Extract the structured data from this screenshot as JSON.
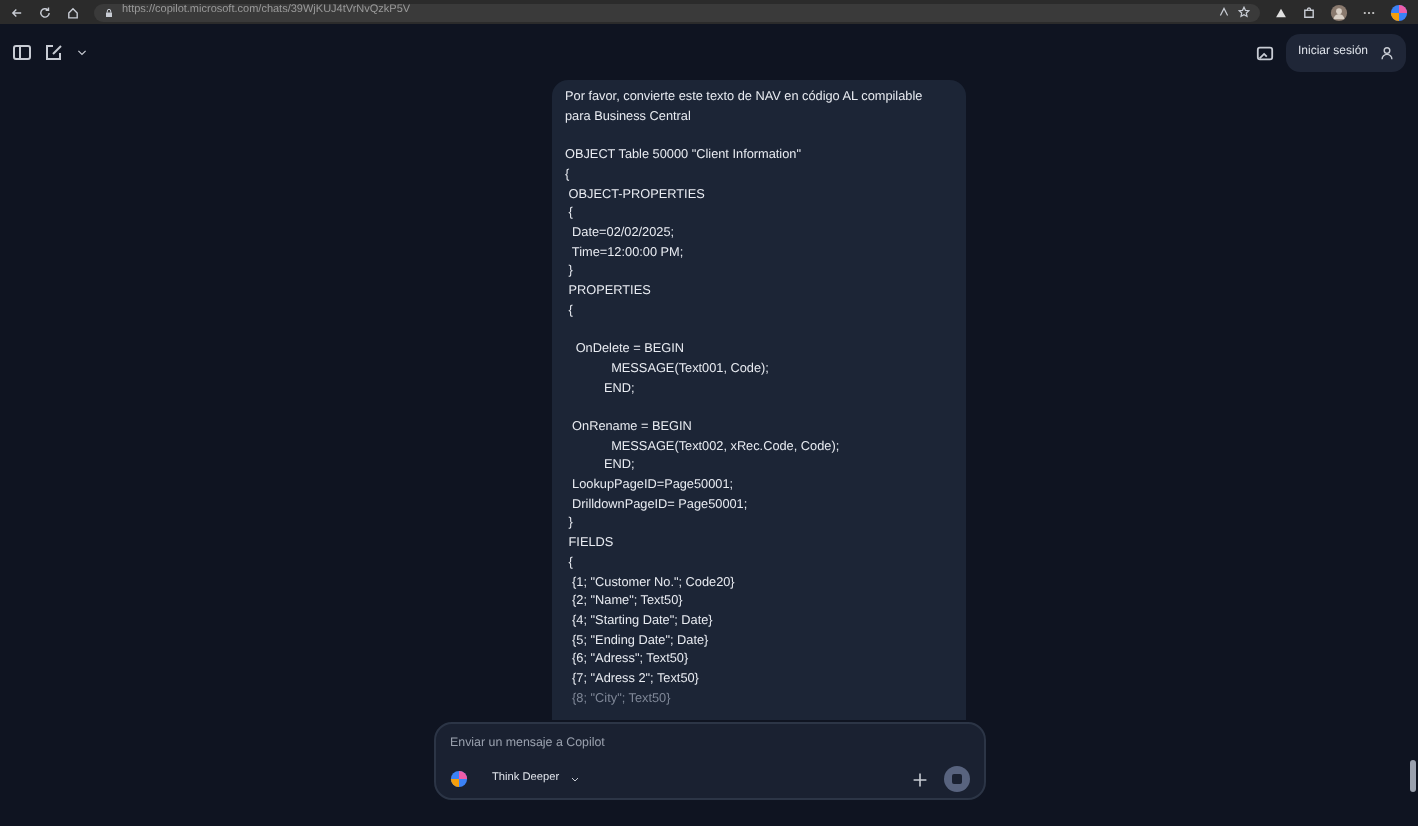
{
  "browser": {
    "url": "https://copilot.microsoft.com/chats/39WjKUJ4tVrNvQzkP5V"
  },
  "header": {
    "sign_in": "Iniciar sesión"
  },
  "message": {
    "blocks": [
      [
        "Por favor, convierte este texto de NAV en código AL compilable",
        "para Business Central"
      ],
      [
        "OBJECT Table 50000 \"Client Information\"",
        "{",
        " OBJECT-PROPERTIES",
        " {",
        "  Date=02/02/2025;",
        "  Time=12:00:00 PM;",
        " }",
        " PROPERTIES",
        " {"
      ],
      [
        "   OnDelete = BEGIN",
        "             MESSAGE(Text001, Code);",
        "           END;"
      ],
      [
        "  OnRename = BEGIN",
        "             MESSAGE(Text002, xRec.Code, Code);",
        "           END;",
        "  LookupPageID=Page50001;",
        "  DrilldownPageID= Page50001;",
        " }",
        " FIELDS",
        " {",
        "  {1; \"Customer No.\"; Code20}",
        "  {2; \"Name\"; Text50}",
        "  {4; \"Starting Date\"; Date}",
        "  {5; \"Ending Date\"; Date}",
        "  {6; \"Adress\"; Text50}",
        "  {7; \"Adress 2\"; Text50}",
        "  {8; \"City\"; Text50}"
      ]
    ]
  },
  "composer": {
    "placeholder": "Enviar un mensaje a Copilot",
    "mode": "Think Deeper"
  }
}
